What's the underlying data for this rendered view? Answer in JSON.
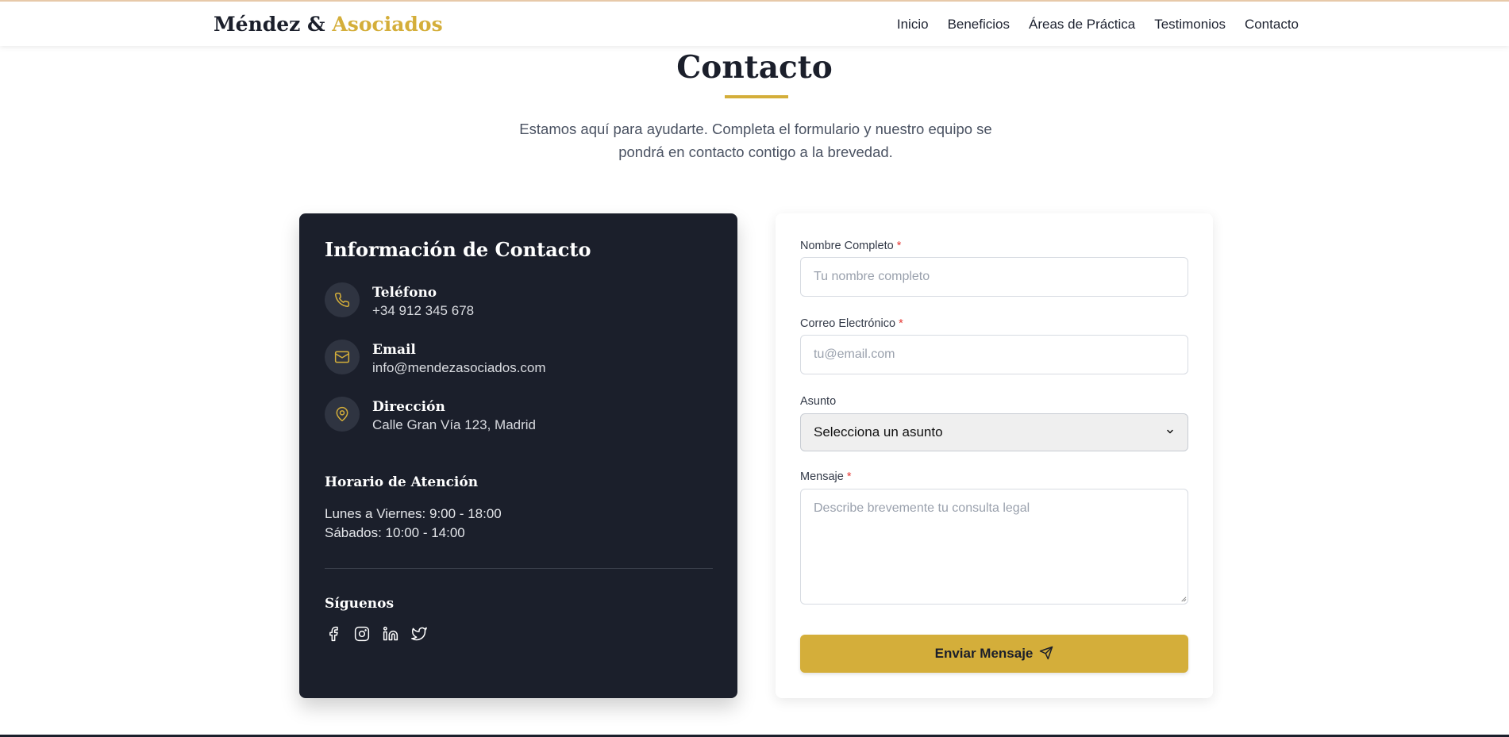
{
  "header": {
    "brand_main": "Méndez &",
    "brand_accent": "Asociados",
    "nav": [
      "Inicio",
      "Beneficios",
      "Áreas de Práctica",
      "Testimonios",
      "Contacto"
    ]
  },
  "section": {
    "title": "Contacto",
    "description": "Estamos aquí para ayudarte. Completa el formulario y nuestro equipo se pondrá en contacto contigo a la brevedad."
  },
  "info": {
    "title": "Información de Contacto",
    "items": [
      {
        "icon": "phone-icon",
        "label": "Teléfono",
        "value": "+34 912 345 678"
      },
      {
        "icon": "mail-icon",
        "label": "Email",
        "value": "info@mendezasociados.com"
      },
      {
        "icon": "map-pin-icon",
        "label": "Dirección",
        "value": "Calle Gran Vía 123, Madrid"
      }
    ],
    "hours_title": "Horario de Atención",
    "hours": [
      "Lunes a Viernes: 9:00 - 18:00",
      "Sábados: 10:00 - 14:00"
    ],
    "follow_title": "Síguenos",
    "socials": [
      "facebook-icon",
      "instagram-icon",
      "linkedin-icon",
      "twitter-icon"
    ]
  },
  "form": {
    "name_label": "Nombre Completo",
    "name_placeholder": "Tu nombre completo",
    "email_label": "Correo Electrónico",
    "email_placeholder": "tu@email.com",
    "subject_label": "Asunto",
    "subject_selected": "Selecciona un asunto",
    "message_label": "Mensaje",
    "message_placeholder": "Describe brevemente tu consulta legal",
    "required_mark": "*",
    "submit_label": "Enviar Mensaje"
  },
  "colors": {
    "accent": "#d4ae3a",
    "dark": "#1b1f2b",
    "required": "#e53935"
  }
}
